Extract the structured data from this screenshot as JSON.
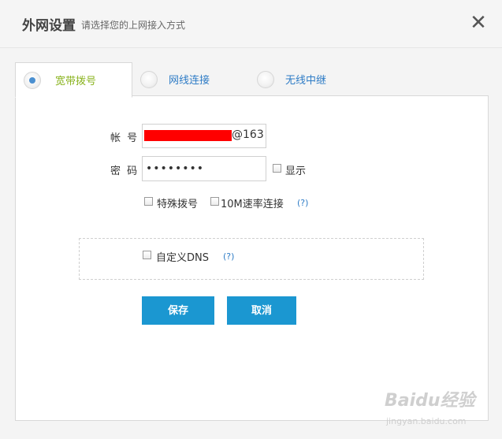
{
  "header": {
    "title": "外网设置",
    "subtitle": "请选择您的上网接入方式",
    "close_symbol": "✕"
  },
  "tabs": [
    {
      "label": "宽带拨号",
      "selected": true
    },
    {
      "label": "网线连接",
      "selected": false
    },
    {
      "label": "无线中继",
      "selected": false
    }
  ],
  "form": {
    "account_label": "帐 号",
    "account_suffix": "@163",
    "password_label": "密 码",
    "password_value": "••••••••",
    "show_label": "显示",
    "special_dial_label": "特殊拨号",
    "speed_10m_label": "10M速率连接",
    "help_text": "(?)",
    "custom_dns_label": "自定义DNS",
    "dns_help_text": "(?)"
  },
  "buttons": {
    "save": "保存",
    "cancel": "取消"
  },
  "colors": {
    "accent_blue": "#1b97d1",
    "active_tab_text": "#8ab31f",
    "link_blue": "#2e7cc6",
    "redaction": "#ff0000"
  },
  "watermark": {
    "text": "Baidu经验",
    "sub": "jingyan.baidu.com"
  }
}
